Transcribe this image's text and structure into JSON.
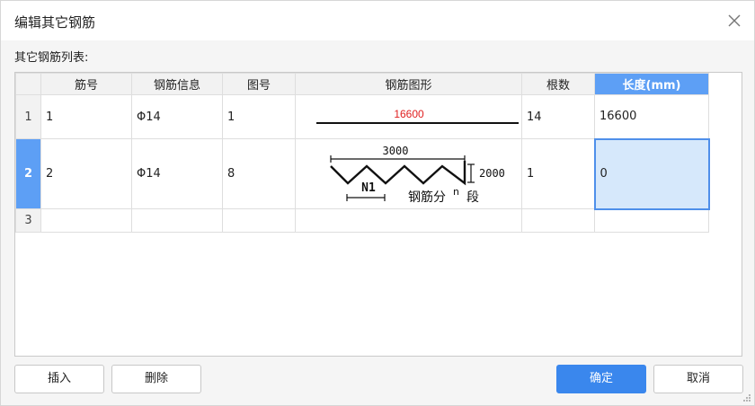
{
  "dialog": {
    "title": "编辑其它钢筋",
    "list_label": "其它钢筋列表:"
  },
  "table": {
    "columns": [
      "筋号",
      "钢筋信息",
      "图号",
      "钢筋图形",
      "根数",
      "长度(mm)"
    ],
    "rows": [
      {
        "num": "1",
        "bar_no": "1",
        "info": "Φ14",
        "figure": "1",
        "shape_label": "16600",
        "count": "14",
        "length": "16600"
      },
      {
        "num": "2",
        "bar_no": "2",
        "info": "Φ14",
        "figure": "8",
        "shape_top": "3000",
        "shape_right": "2000",
        "shape_n1": "N1",
        "shape_caption": "钢筋分",
        "shape_n": "n",
        "shape_caption_end": "段",
        "count": "1",
        "length": "0"
      },
      {
        "num": "3",
        "bar_no": "",
        "info": "",
        "figure": "",
        "count": "",
        "length": ""
      }
    ]
  },
  "buttons": {
    "insert": "插入",
    "delete": "删除",
    "ok": "确定",
    "cancel": "取消"
  },
  "colors": {
    "accent": "#3a87ed",
    "header_active": "#5d9ff5",
    "selected_cell": "#d6e8fb",
    "shape_red_label": "#e02020"
  },
  "icons": {
    "close": "close-icon",
    "resize": "resize-grip-icon"
  }
}
